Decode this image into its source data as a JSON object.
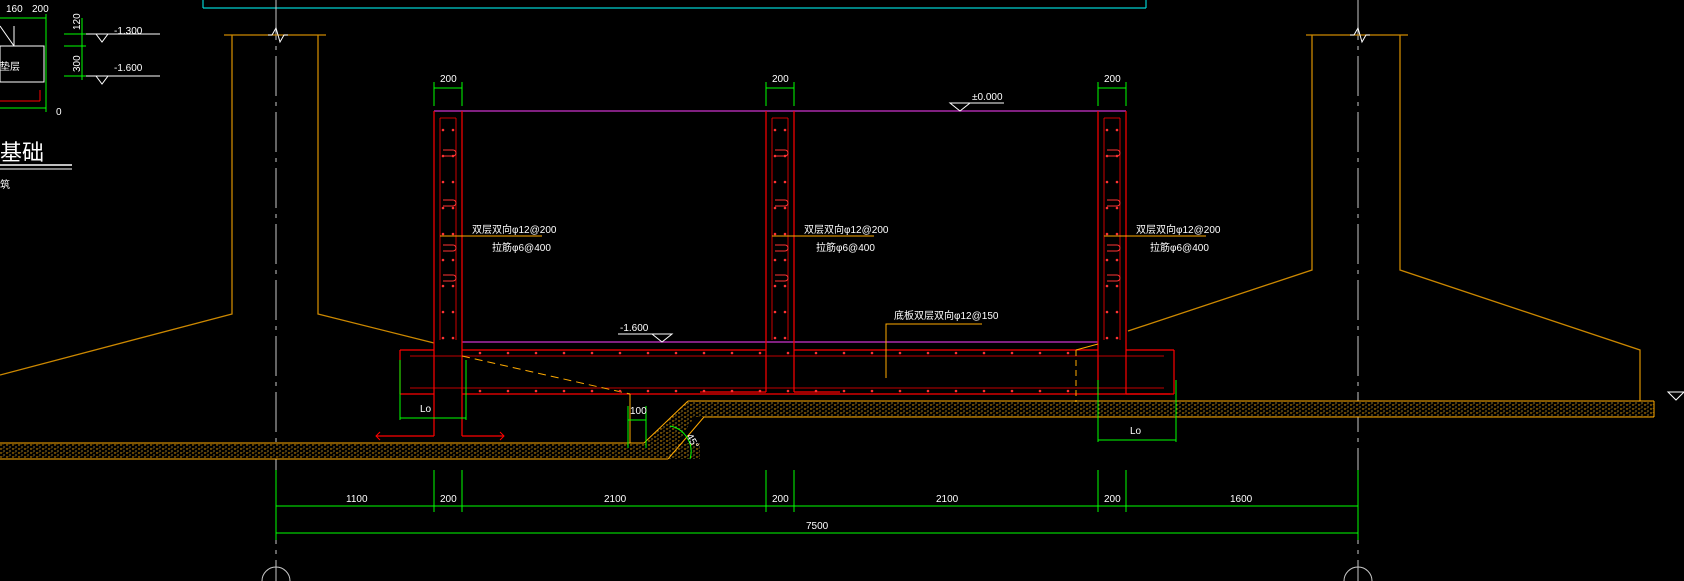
{
  "colors": {
    "background": "#000000",
    "dimension": "#00ff00",
    "concrete_wall": "#ff0000",
    "slab_line": "#cc33cc",
    "soil": "#ffaa00",
    "text_white": "#ffffff",
    "axis": "#c8c8c8",
    "frame": "#00d0d0"
  },
  "detail": {
    "dims_top": [
      "160",
      "200"
    ],
    "dims_side": [
      "120",
      "300"
    ],
    "elevations": [
      "-1.300",
      "-1.600"
    ],
    "label_fragment": "基础",
    "label_fragment2": "筑",
    "tag": "垫层"
  },
  "section": {
    "wall_width_labels": [
      "200",
      "200",
      "200"
    ],
    "top_elevation": "±0.000",
    "bottom_elevation": "-1.600",
    "rebar_left": [
      "双层双向φ12@200",
      "拉筋φ6@400"
    ],
    "rebar_mid": [
      "双层双向φ12@200",
      "拉筋φ6@400"
    ],
    "rebar_right": [
      "双层双向φ12@200",
      "拉筋φ6@400"
    ],
    "slab_rebar": "底板双层双向φ12@150",
    "anchor_left": "Lo",
    "anchor_right": "Lo",
    "step_height": "100",
    "slope_angle": "45°"
  },
  "bottom_dims": {
    "segments": [
      "1100",
      "200",
      "2100",
      "200",
      "2100",
      "200",
      "1600"
    ],
    "total": "7500"
  }
}
